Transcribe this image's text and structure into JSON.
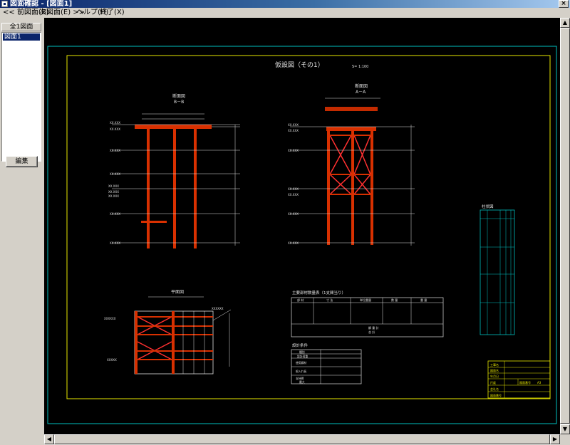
{
  "window": {
    "title": "図面確認 - [図面1]",
    "close_glyph": "×"
  },
  "menu": {
    "prev": "<< 前図面(B)",
    "next": "次図面(E) >>",
    "help": "ヘルプ(H)",
    "exit": "終了(X)"
  },
  "sidebar": {
    "header": "全1図面",
    "items": [
      {
        "label": "図面1",
        "selected": true
      }
    ],
    "edit_button": "編集"
  },
  "drawing": {
    "title": "仮設図（その1）",
    "scale": "S= 1:100",
    "section_b": {
      "title": "断面図",
      "subtitle": "B－B"
    },
    "section_a": {
      "title": "断面図",
      "subtitle": "A－A"
    },
    "plan": {
      "title": "平面図"
    },
    "column": {
      "title": "柱状図"
    },
    "quantity_table": {
      "title": "主要部材数量表（1支間当り）",
      "headers": [
        "部 材",
        "寸 法",
        "単位重量",
        "数 量",
        "重 量"
      ],
      "totals": [
        "鋼 重 計",
        "合 計"
      ]
    },
    "design_conditions": {
      "title": "設計条件",
      "rows": [
        "種別",
        "設計荷重",
        "使用鋼材",
        "根入れ長",
        "支持層",
        "最大"
      ]
    },
    "title_block": {
      "rows": [
        "工事名",
        "図面名",
        "年月日",
        "尺度",
        "会社名",
        "図面番号"
      ],
      "scale_label": "図面番号",
      "scale_value": "A3"
    }
  },
  "colors": {
    "canvas_bg": "#000000",
    "outer_frame": "#00c0c0",
    "inner_frame": "#e8e800",
    "steel": "#d83000",
    "brace": "#ff3030",
    "dims": "#e0e0e0",
    "selection": "#0a246a"
  }
}
